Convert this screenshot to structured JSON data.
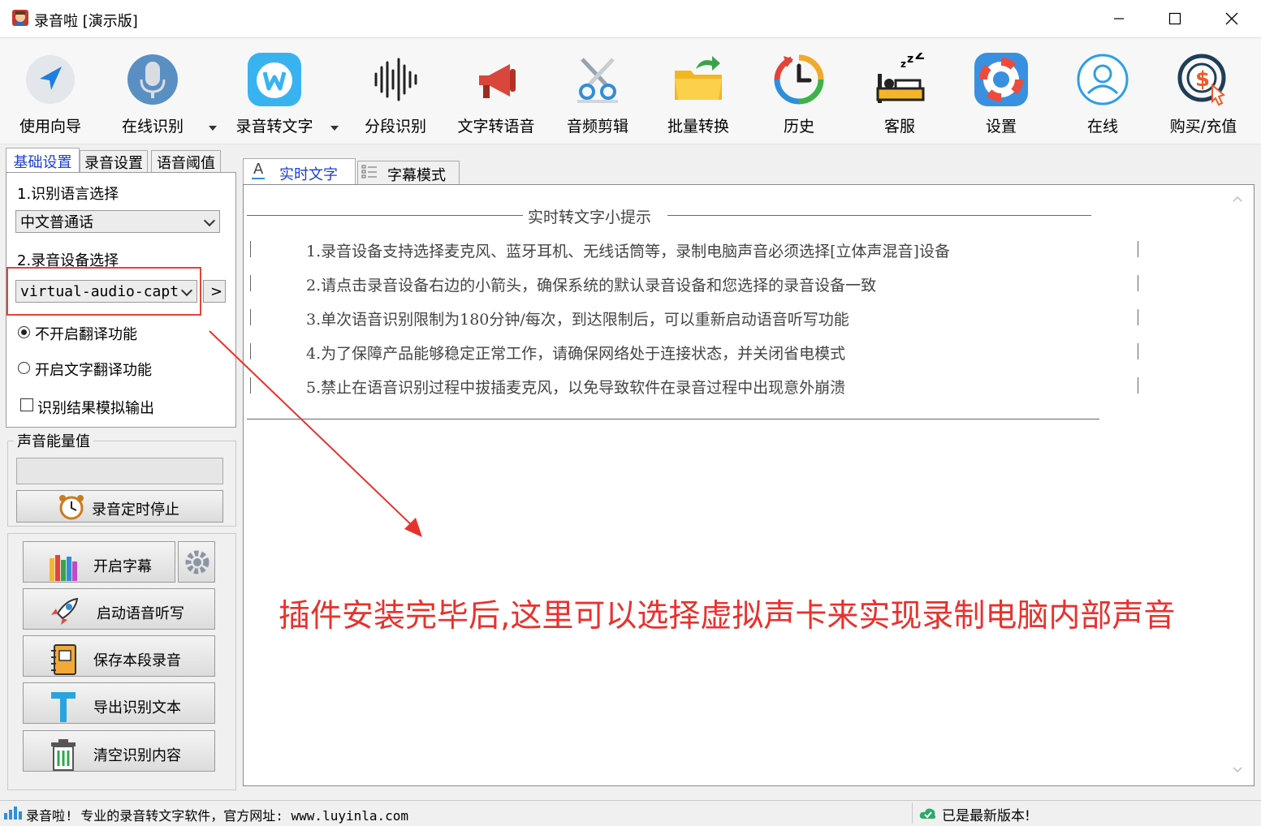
{
  "window": {
    "title": "录音啦 [演示版]"
  },
  "toolbar": {
    "items": [
      {
        "label": "使用向导",
        "icon": "navigation-arrow-icon"
      },
      {
        "label": "在线识别",
        "icon": "microphone-icon"
      },
      {
        "label": "录音转文字",
        "icon": "w-logo-icon"
      },
      {
        "label": "分段识别",
        "icon": "sound-wave-icon"
      },
      {
        "label": "文字转语音",
        "icon": "megaphone-icon"
      },
      {
        "label": "音频剪辑",
        "icon": "scissors-icon"
      },
      {
        "label": "批量转换",
        "icon": "folder-icon"
      },
      {
        "label": "历史",
        "icon": "history-clock-icon"
      },
      {
        "label": "客服",
        "icon": "sleeping-bed-icon"
      },
      {
        "label": "设置",
        "icon": "lifebuoy-icon"
      },
      {
        "label": "在线",
        "icon": "user-avatar-icon"
      },
      {
        "label": "购买/充值",
        "icon": "dollar-coin-icon"
      }
    ]
  },
  "left_tabs": [
    "基础设置",
    "录音设置",
    "语音阈值"
  ],
  "settings": {
    "lang_label": "1.识别语言选择",
    "lang_value": "中文普通话",
    "device_label": "2.录音设备选择",
    "device_value": "virtual-audio-capt",
    "device_more": ">",
    "radio_off": "不开启翻译功能",
    "radio_on": "开启文字翻译功能",
    "checkbox": "识别结果模拟输出"
  },
  "energy": {
    "label": "声音能量值",
    "level": 0,
    "timer_button": "录音定时停止"
  },
  "actions": {
    "subtitle": "开启字幕",
    "dictation": "启动语音听写",
    "save": "保存本段录音",
    "export": "导出识别文本",
    "clear": "清空识别内容"
  },
  "main_tabs": [
    "实时文字",
    "字幕模式"
  ],
  "tips": {
    "header": "实时转文字小提示",
    "lines": [
      "1.录音设备支持选择麦克风、蓝牙耳机、无线话筒等，录制电脑声音必须选择[立体声混音]设备",
      "2.请点击录音设备右边的小箭头，确保系统的默认录音设备和您选择的录音设备一致",
      "3.单次语音识别限制为180分钟/每次，到达限制后，可以重新启动语音听写功能",
      "4.为了保障产品能够稳定正常工作，请确保网络处于连接状态，并关闭省电模式",
      "5.禁止在语音识别过程中拔插麦克风，以免导致软件在录音过程中出现意外崩溃"
    ]
  },
  "annotation": {
    "text": "插件安装完毕后,这里可以选择虚拟声卡来实现录制电脑内部声音",
    "color": "#e8322d"
  },
  "status": {
    "left": "录音啦! 专业的录音转文字软件，官方网址: www.luyinla.com",
    "right": "已是最新版本!"
  }
}
